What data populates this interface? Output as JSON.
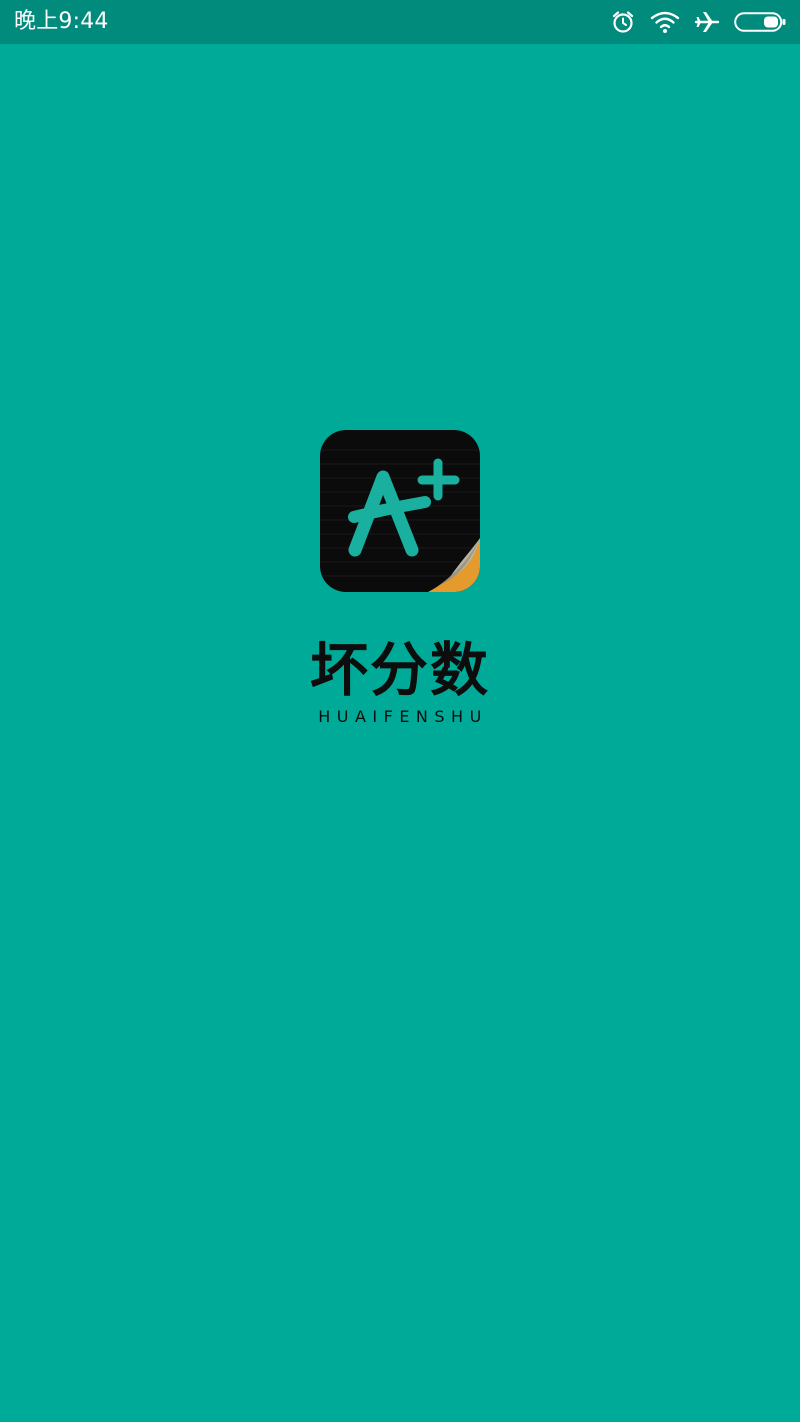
{
  "status_bar": {
    "time": "晚上9:44",
    "icons": [
      "alarm-icon",
      "wifi-icon",
      "airplane-mode-icon",
      "battery-icon"
    ],
    "background": "#008b7c"
  },
  "splash": {
    "background": "#00aa99",
    "app_icon": {
      "glyph": "A",
      "superscript": "+",
      "tile_color": "#0b0b0b",
      "glyph_color": "#19b0a0",
      "page_curl_colors": [
        "#e59a2e",
        "#b9b4a0"
      ]
    },
    "brand_name": "坏分数",
    "brand_pinyin": "HUAIFENSHU"
  }
}
